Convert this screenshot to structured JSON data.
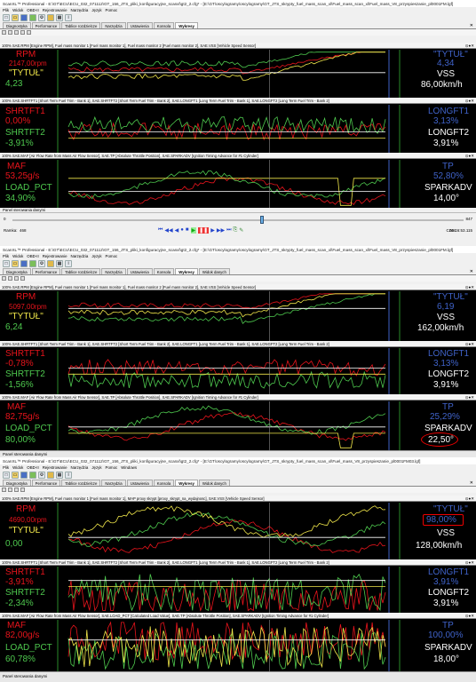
{
  "window": {
    "title": "ScanXL™ Professional - E:\\GT\\ECU\\ECU_032_071112\\GT_156_JTS_pliki_konfiguracyjne_scanxl\\gt2_2.cfg* - [E:\\GT\\oscylogramy\\oscylogramy\\GT_JTS_skrypty_fuel_mass_scan_xl\\Fuel_mass_scan_xl\\Fuel_mass_V8_przyspieszanie_pl0001FM.lgf]",
    "title2": "ScanXL™ Professional - E:\\GT\\ECU\\ECU_032_071112\\GT_156_JTS_pliki_konfiguracyjne_scanxl\\gt2_2.cfg* - [E:\\GT\\oscylogramy\\oscylogramy\\GT_JTS_skrypty_fuel_mass_scan_xl\\Fuel_mass_V8_przyspieszanie_pl0001FM03.lgf]"
  },
  "menu": [
    "Plik",
    "Widok",
    "OBD-II",
    "Rejestrowanie",
    "Narzędzia",
    "Język",
    "Pomoc"
  ],
  "menu3": [
    "Plik",
    "Widok",
    "OBD-II",
    "Rejestrowanie",
    "Narzędzia",
    "Język",
    "Pomoc",
    "Windows"
  ],
  "tabs": [
    "Diagnostyka",
    "Performance",
    "Tablice rozdzielcze",
    "Narzędzia",
    "Ustawienia",
    "Konsola",
    "Wykresy",
    "Widok danych"
  ],
  "tabs1": [
    "Diagnostyka",
    "Performance",
    "Tablice rozdzielcze",
    "Narzędzia",
    "Ustawienia",
    "Konsola",
    "Wykresy"
  ],
  "headers": {
    "a1": "100% SAE.RPM [Engine RPM], Fuel mass monitor 1 [Fuel mass monitor 1], Fuel mass monitor 2 [Fuel mass monitor 2], SAE.VSS [Vehicle Speed Sensor]",
    "a2": "100% SAE.SHRTFT1 [Short Term Fuel Trim - Bank 1], SAE.SHRTFT2 [Short Term Fuel Trim - Bank 2], SAE.LONGFT1 [Long Term Fuel Trim - Bank 1], SAE.LONGFT2 [Long Term Fuel Trim - Bank 2]",
    "a3": "100% SAE.MAF [Air Flow Rate from Mass Air Flow Sensor], SAE.TP [Absolute Throttle Position], SAE.SPARKADV [Ignition Timing Advance for #1 Cylinder]",
    "c1": "100% SAE.RPM [Engine RPM], Fuel mass monitor 1 [Fuel mass monitor 1], MAP proxy skrypt [proxy_skrypt_na_wydajnosc], SAE.VSS [Vehicle Speed Sensor]",
    "c3": "100% SAE.MAF [Air Flow Rate from Mass Air Flow Sensor], SAE.LOAD_PCT [Calculated Load Value], SAE.TP [Absolute Throttle Position], SAE.SPARKADV [Ignition Timing Advance for #1 Cylinder]"
  },
  "s1": {
    "rpm": "RPM",
    "rpm_val": "2147,00rpm",
    "tytul": "\"TYTUŁ\"",
    "tytul_val": "4,23",
    "tytul_r": "\"TYTUŁ\"",
    "tytul_r_val": "4,34",
    "vss": "VSS",
    "vss_val": "86,00km/h",
    "shrtft1": "SHRTFT1",
    "shrtft1_val": "0,00%",
    "shrtft2": "SHRTFT2",
    "shrtft2_val": "-3,91%",
    "longft1": "LONGFT1",
    "longft1_val": "3,13%",
    "longft2": "LONGFT2",
    "longft2_val": "3,91%",
    "maf": "MAF",
    "maf_val": "53,25g/s",
    "load": "LOAD_PCT",
    "load_val": "34,90%",
    "tp": "TP",
    "tp_val": "52,80%",
    "spark": "SPARKADV",
    "spark_val": "14,00°"
  },
  "s2": {
    "rpm_val": "5097,00rpm",
    "tytul_val": "6,24",
    "tytul_r_val": "6,19",
    "vss_val": "162,00km/h",
    "shrtft1_val": "-0,78%",
    "shrtft2_val": "-1,56%",
    "longft1_val": "3,13%",
    "longft2_val": "3,91%",
    "maf_val": "82,75g/s",
    "load_val": "80,00%",
    "tp_val": "25,29%",
    "spark_val": "22,50°"
  },
  "s3": {
    "rpm_val": "4690,00rpm",
    "tytul_val": "0,00",
    "tytul_r_val": "98,00%",
    "vss_val": "128,00km/h",
    "shrtft1_val": "-3,91%",
    "shrtft2_val": "-2,34%",
    "longft1_val": "3,91%",
    "longft2_val": "3,91%",
    "maf_val": "82,00g/s",
    "load_val": "60,78%",
    "tp_val": "100,00%",
    "spark_val": "18,00°"
  },
  "panel_status": "Panel sterowania danymi",
  "playback": {
    "start": "0",
    "end": "847",
    "ramka_label": "Ramka:",
    "ramka_val": "468",
    "czas_label": "Czas:",
    "czas_val": "00:16:53.115",
    "progress": 0.55
  },
  "scale": {
    "left": [
      "5.0",
      "4.0",
      "3.0",
      "2.0",
      "1.0",
      "0.0"
    ],
    "right": [
      "150",
      "100",
      "50",
      "0"
    ]
  },
  "colors": {
    "red": "#e8141c",
    "green": "#4ec94e",
    "yellow": "#f0e64a",
    "white": "#ffffff",
    "blue": "#3f62c8"
  }
}
